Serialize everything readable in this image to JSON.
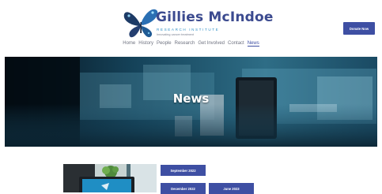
{
  "brand": {
    "name": "Gillies McIndoe",
    "subtitle": "RESEARCH INSTITUTE",
    "tagline": "Innovating cancer treatment"
  },
  "header": {
    "donate_label": "Donate Now"
  },
  "nav": {
    "items": [
      {
        "label": "Home"
      },
      {
        "label": "History"
      },
      {
        "label": "People"
      },
      {
        "label": "Research"
      },
      {
        "label": "Get Involved"
      },
      {
        "label": "Contact"
      },
      {
        "label": "News"
      }
    ],
    "active": "News"
  },
  "hero": {
    "title": "News"
  },
  "archive": {
    "links": [
      {
        "label": "September 2022"
      },
      {
        "label": "December 2022"
      },
      {
        "label": "June 2023"
      }
    ]
  },
  "colors": {
    "brand_blue": "#3e4fa3",
    "brand_light_blue": "#2f8fc7",
    "nav_text": "#6f7380"
  },
  "icons": {
    "logo": "butterfly-logo-icon"
  }
}
